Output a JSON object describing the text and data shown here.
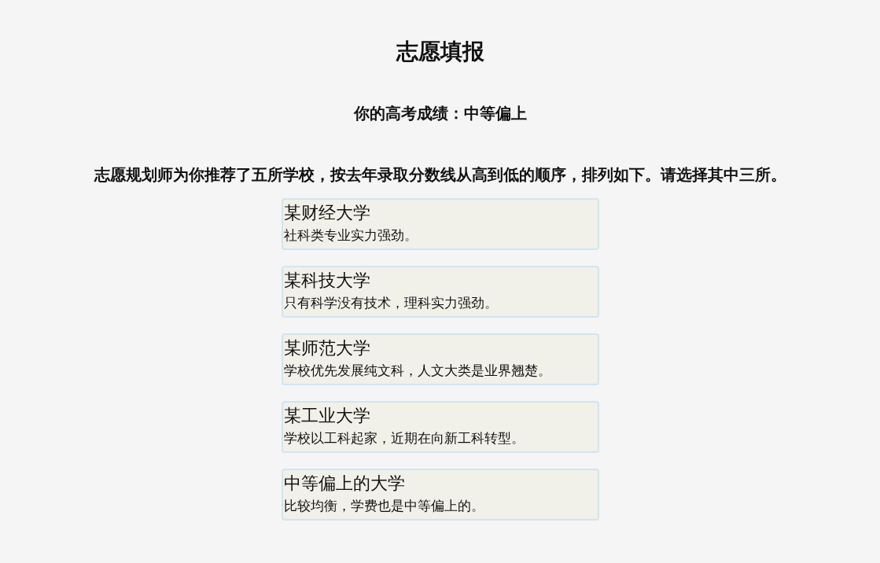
{
  "title": "志愿填报",
  "score_line": "你的高考成绩：中等偏上",
  "instruction": "志愿规划师为你推荐了五所学校，按去年录取分数线从高到低的顺序，排列如下。请选择其中三所。",
  "schools": [
    {
      "name": "某财经大学",
      "description": "社科类专业实力强劲。"
    },
    {
      "name": "某科技大学",
      "description": "只有科学没有技术，理科实力强劲。"
    },
    {
      "name": "某师范大学",
      "description": "学校优先发展纯文科，人文大类是业界翘楚。"
    },
    {
      "name": "某工业大学",
      "description": "学校以工科起家，近期在向新工科转型。"
    },
    {
      "name": "中等偏上的大学",
      "description": "比较均衡，学费也是中等偏上的。"
    }
  ]
}
